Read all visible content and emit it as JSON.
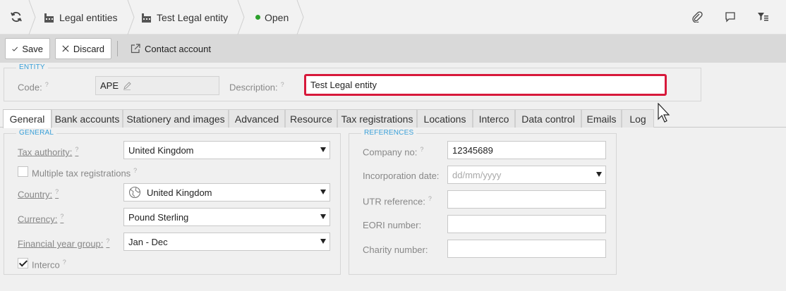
{
  "breadcrumb": {
    "refresh_icon": "refresh-icon",
    "items": [
      "Legal entities",
      "Test Legal entity"
    ],
    "status": "Open",
    "status_color": "#2ca02c"
  },
  "header_icons": [
    "attach-icon",
    "comment-icon",
    "filter-list-icon"
  ],
  "toolbar": {
    "save_label": "Save",
    "discard_label": "Discard",
    "contact_label": "Contact account"
  },
  "entity": {
    "legend": "ENTITY",
    "code_label": "Code:",
    "code_value": "APE",
    "description_label": "Description:",
    "description_value": "Test Legal entity",
    "help": "?"
  },
  "tabs": [
    "General",
    "Bank accounts",
    "Stationery and images",
    "Advanced",
    "Resource",
    "Tax registrations",
    "Locations",
    "Interco",
    "Data control",
    "Emails",
    "Log"
  ],
  "active_tab": "General",
  "general": {
    "legend": "GENERAL",
    "tax_authority_label": "Tax authority:",
    "tax_authority_value": "United Kingdom",
    "multiple_tax_label": "Multiple tax registrations",
    "multiple_tax_checked": false,
    "country_label": "Country:",
    "country_value": "United Kingdom",
    "currency_label": "Currency:",
    "currency_value": "Pound Sterling",
    "fy_group_label": "Financial year group:",
    "fy_group_value": "Jan - Dec",
    "interco_label": "Interco",
    "interco_checked": true
  },
  "references": {
    "legend": "REFERENCES",
    "company_no_label": "Company no:",
    "company_no_value": "12345689",
    "incorporation_label": "Incorporation date:",
    "incorporation_placeholder": "dd/mm/yyyy",
    "utr_label": "UTR reference:",
    "utr_value": "",
    "eori_label": "EORI number:",
    "eori_value": "",
    "charity_label": "Charity number:",
    "charity_value": ""
  },
  "colors": {
    "accent": "#3aa0d8",
    "highlight": "#d7193b"
  }
}
